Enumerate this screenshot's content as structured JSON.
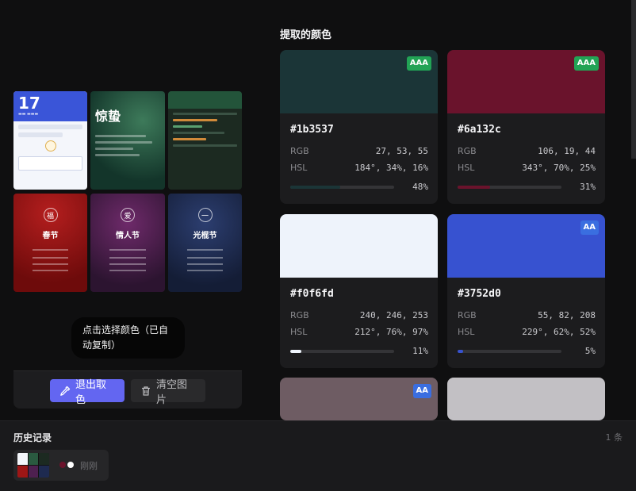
{
  "palette": {
    "title": "提取的颜色",
    "labels": {
      "rgb": "RGB",
      "hsl": "HSL"
    },
    "swatches": [
      {
        "hex": "#1b3537",
        "color": "#1b3537",
        "badge": "AAA",
        "rgb": "27, 53, 55",
        "hsl": "184°, 34%, 16%",
        "percent": "48%",
        "fraction": 0.48,
        "bar_color": "#1b3537"
      },
      {
        "hex": "#6a132c",
        "color": "#6a132c",
        "badge": "AAA",
        "rgb": "106, 19, 44",
        "hsl": "343°, 70%, 25%",
        "percent": "31%",
        "fraction": 0.31,
        "bar_color": "#6a132c"
      },
      {
        "hex": "#f0f6fd",
        "color": "#eef3fb",
        "badge": "",
        "rgb": "240, 246, 253",
        "hsl": "212°, 76%, 97%",
        "percent": "11%",
        "fraction": 0.11,
        "bar_color": "#f0f6fd"
      },
      {
        "hex": "#3752d0",
        "color": "#3752d0",
        "badge": "AA",
        "rgb": "55, 82, 208",
        "hsl": "229°, 62%, 52%",
        "percent": "5%",
        "fraction": 0.05,
        "bar_color": "#3752d0"
      },
      {
        "hex": "",
        "color": "#6e5c63",
        "badge": "AA",
        "rgb": "",
        "hsl": "",
        "percent": "",
        "fraction": 0,
        "bar_color": "#6e5c63"
      },
      {
        "hex": "",
        "color": "#c2c0c4",
        "badge": "",
        "rgb": "",
        "hsl": "",
        "percent": "",
        "fraction": 0,
        "bar_color": "#c2c0c4"
      }
    ]
  },
  "preview": {
    "calendar_day": "17",
    "card_titles": {
      "green": "惊蛰",
      "festival_1": "春节",
      "festival_2": "情人节",
      "festival_3": "光棍节"
    },
    "festival_glyphs": [
      "福",
      "爱",
      "一"
    ]
  },
  "tooltip": {
    "text": "点击选择颜色（已自动复制）"
  },
  "toolbar": {
    "exit_label": "退出取色",
    "clear_label": "清空图片"
  },
  "history": {
    "title": "历史记录",
    "count": "1 条",
    "items": [
      {
        "time": "刚刚",
        "dots": [
          "#6a132c",
          "#ffffff"
        ]
      }
    ]
  },
  "colors": {
    "accent": "#6366f1",
    "aaa": "#22a355",
    "aa": "#3a6ee0"
  }
}
